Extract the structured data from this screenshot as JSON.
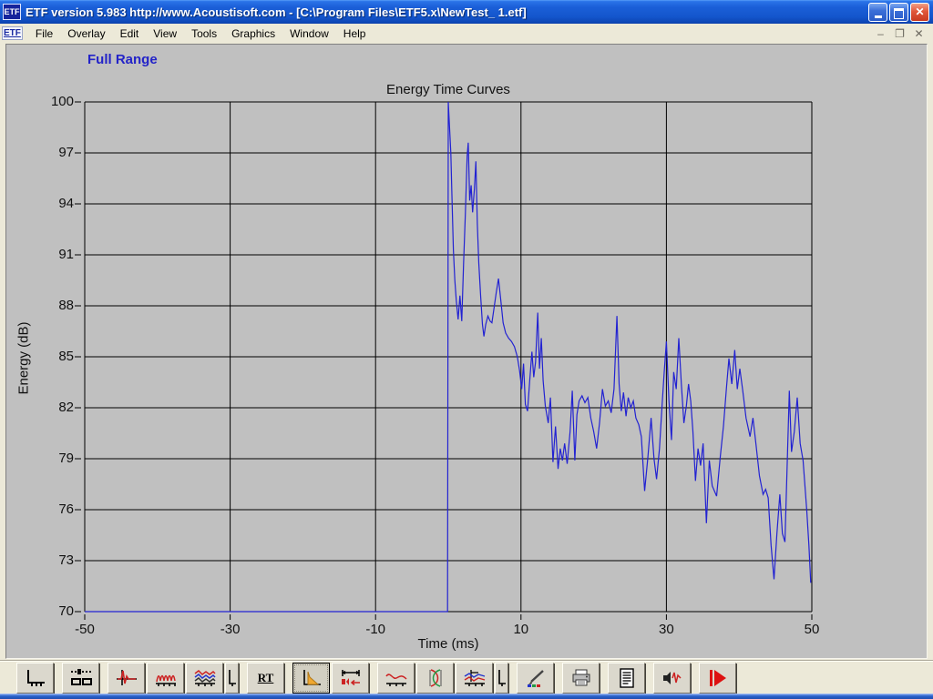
{
  "window": {
    "title": "ETF version 5.983 http://www.Acoustisoft.com - [C:\\Program Files\\ETF5.x\\NewTest_ 1.etf]",
    "app_icon_label": "ETF",
    "controls": {
      "minimize": "",
      "restore": "",
      "close": "✕"
    }
  },
  "menu": {
    "mdi_icon_label": "ETF",
    "items": [
      "File",
      "Overlay",
      "Edit",
      "View",
      "Tools",
      "Graphics",
      "Window",
      "Help"
    ],
    "mdi_controls": {
      "minimize": "–",
      "restore": "❐",
      "close": "✕"
    }
  },
  "view_label": "Full Range",
  "chart_data": {
    "type": "line",
    "title": "Energy Time Curves",
    "xlabel": "Time (ms)",
    "ylabel": "Energy (dB)",
    "xlim": [
      -50,
      50
    ],
    "ylim": [
      70,
      100
    ],
    "xticks": [
      -50,
      -30,
      -10,
      10,
      30,
      50
    ],
    "yticks": [
      70,
      73,
      76,
      79,
      82,
      85,
      88,
      91,
      94,
      97,
      100
    ],
    "grid": true,
    "legend": "none",
    "line_color": "#2222d2",
    "series": [
      {
        "name": "Energy Time Curve",
        "points": [
          [
            -50,
            70
          ],
          [
            -0.1,
            70
          ],
          [
            0,
            100
          ],
          [
            0.35,
            97
          ],
          [
            0.5,
            94.5
          ],
          [
            0.7,
            91.3
          ],
          [
            0.9,
            89.5
          ],
          [
            1.1,
            88.3
          ],
          [
            1.35,
            87.2
          ],
          [
            1.6,
            88.6
          ],
          [
            1.85,
            87.1
          ],
          [
            2.1,
            90.5
          ],
          [
            2.35,
            93.5
          ],
          [
            2.6,
            96.8
          ],
          [
            2.75,
            97.6
          ],
          [
            2.95,
            94.2
          ],
          [
            3.15,
            95.1
          ],
          [
            3.35,
            93.5
          ],
          [
            3.6,
            94.9
          ],
          [
            3.8,
            96.5
          ],
          [
            4.0,
            92.8
          ],
          [
            4.2,
            90.5
          ],
          [
            4.45,
            88.6
          ],
          [
            4.7,
            86.9
          ],
          [
            4.9,
            86.2
          ],
          [
            5.15,
            86.9
          ],
          [
            5.45,
            87.4
          ],
          [
            5.75,
            87.1
          ],
          [
            6.0,
            87.0
          ],
          [
            6.3,
            87.9
          ],
          [
            6.6,
            88.8
          ],
          [
            6.9,
            89.6
          ],
          [
            7.2,
            88.4
          ],
          [
            7.55,
            87.0
          ],
          [
            7.9,
            86.4
          ],
          [
            8.3,
            86.1
          ],
          [
            8.7,
            85.9
          ],
          [
            9.1,
            85.6
          ],
          [
            9.5,
            85.0
          ],
          [
            9.8,
            84.2
          ],
          [
            10.1,
            83.1
          ],
          [
            10.35,
            84.6
          ],
          [
            10.6,
            82.2
          ],
          [
            10.9,
            81.8
          ],
          [
            11.2,
            83.6
          ],
          [
            11.5,
            85.3
          ],
          [
            11.75,
            83.8
          ],
          [
            12.0,
            84.7
          ],
          [
            12.3,
            87.6
          ],
          [
            12.55,
            84.3
          ],
          [
            12.8,
            86.1
          ],
          [
            13.05,
            83.6
          ],
          [
            13.35,
            82.1
          ],
          [
            13.75,
            81.1
          ],
          [
            14.05,
            82.6
          ],
          [
            14.4,
            78.8
          ],
          [
            14.75,
            80.9
          ],
          [
            15.1,
            78.4
          ],
          [
            15.4,
            79.6
          ],
          [
            15.7,
            78.9
          ],
          [
            16.0,
            79.9
          ],
          [
            16.35,
            78.7
          ],
          [
            16.75,
            80.6
          ],
          [
            17.05,
            83.0
          ],
          [
            17.4,
            78.9
          ],
          [
            17.7,
            81.6
          ],
          [
            18.0,
            82.4
          ],
          [
            18.4,
            82.7
          ],
          [
            18.8,
            82.3
          ],
          [
            19.2,
            82.6
          ],
          [
            19.6,
            81.4
          ],
          [
            20.0,
            80.6
          ],
          [
            20.4,
            79.6
          ],
          [
            20.8,
            81.1
          ],
          [
            21.2,
            83.1
          ],
          [
            21.6,
            82.1
          ],
          [
            22.0,
            82.4
          ],
          [
            22.4,
            81.7
          ],
          [
            22.8,
            83.1
          ],
          [
            23.2,
            87.4
          ],
          [
            23.5,
            83.4
          ],
          [
            23.8,
            81.8
          ],
          [
            24.1,
            82.9
          ],
          [
            24.45,
            81.5
          ],
          [
            24.75,
            82.6
          ],
          [
            25.1,
            82.0
          ],
          [
            25.45,
            82.4
          ],
          [
            25.8,
            81.4
          ],
          [
            26.2,
            81.0
          ],
          [
            26.55,
            80.3
          ],
          [
            27.0,
            77.1
          ],
          [
            27.45,
            79.1
          ],
          [
            27.9,
            81.4
          ],
          [
            28.3,
            79.0
          ],
          [
            28.65,
            77.8
          ],
          [
            29.05,
            79.6
          ],
          [
            29.4,
            82.1
          ],
          [
            29.7,
            84.1
          ],
          [
            30.0,
            85.9
          ],
          [
            30.35,
            82.4
          ],
          [
            30.7,
            80.1
          ],
          [
            31.0,
            84.1
          ],
          [
            31.35,
            83.1
          ],
          [
            31.7,
            86.1
          ],
          [
            32.05,
            83.4
          ],
          [
            32.4,
            81.1
          ],
          [
            32.75,
            82.1
          ],
          [
            33.05,
            83.4
          ],
          [
            33.35,
            82.4
          ],
          [
            33.65,
            80.6
          ],
          [
            34.0,
            77.7
          ],
          [
            34.35,
            79.6
          ],
          [
            34.7,
            78.6
          ],
          [
            35.05,
            79.9
          ],
          [
            35.5,
            75.2
          ],
          [
            35.9,
            78.9
          ],
          [
            36.3,
            77.4
          ],
          [
            36.9,
            76.8
          ],
          [
            37.4,
            79.1
          ],
          [
            37.85,
            80.9
          ],
          [
            38.25,
            83.1
          ],
          [
            38.6,
            84.9
          ],
          [
            39.0,
            83.4
          ],
          [
            39.4,
            85.4
          ],
          [
            39.75,
            83.1
          ],
          [
            40.1,
            84.3
          ],
          [
            40.5,
            83.0
          ],
          [
            40.95,
            81.4
          ],
          [
            41.5,
            80.3
          ],
          [
            41.9,
            81.4
          ],
          [
            42.3,
            79.9
          ],
          [
            42.8,
            78.0
          ],
          [
            43.3,
            76.9
          ],
          [
            43.65,
            77.2
          ],
          [
            44.0,
            76.7
          ],
          [
            44.4,
            73.9
          ],
          [
            44.8,
            71.9
          ],
          [
            45.2,
            74.6
          ],
          [
            45.6,
            76.9
          ],
          [
            45.95,
            74.6
          ],
          [
            46.3,
            74.1
          ],
          [
            46.9,
            83.0
          ],
          [
            47.2,
            79.4
          ],
          [
            47.6,
            80.6
          ],
          [
            48.0,
            82.6
          ],
          [
            48.4,
            79.9
          ],
          [
            48.8,
            78.9
          ],
          [
            49.3,
            76.0
          ],
          [
            49.6,
            73.9
          ],
          [
            49.85,
            71.7
          ]
        ]
      }
    ]
  },
  "toolbar": {
    "buttons": [
      {
        "icon": "axis-scale-icon"
      },
      {
        "icon": "slider-panels-icon"
      },
      {
        "icon": "impulse-response-icon"
      },
      {
        "icon": "frequency-response-icon"
      },
      {
        "icon": "waterfall-icon"
      },
      {
        "icon": "axis-toggle-icon"
      },
      {
        "icon": "rt-text-icon",
        "label": "RT"
      },
      {
        "icon": "energy-time-curve-icon",
        "active": true
      },
      {
        "icon": "gate-window-icon"
      },
      {
        "icon": "smoothed-response-icon"
      },
      {
        "icon": "phase-icon"
      },
      {
        "icon": "overlay-curves-icon"
      },
      {
        "icon": "axis-toggle-icon"
      },
      {
        "icon": "color-pen-icon"
      },
      {
        "icon": "printer-icon"
      },
      {
        "icon": "report-icon"
      },
      {
        "icon": "speaker-test-icon"
      },
      {
        "icon": "play-measure-icon"
      }
    ]
  },
  "colors": {
    "window_gray": "#c0c0c0",
    "xp_tan": "#ece9d8",
    "titlebar_blue": "#1456cc",
    "view_label_blue": "#2323c8",
    "curve_blue": "#2222d2",
    "taskbar_blue": "#2a60c8"
  }
}
